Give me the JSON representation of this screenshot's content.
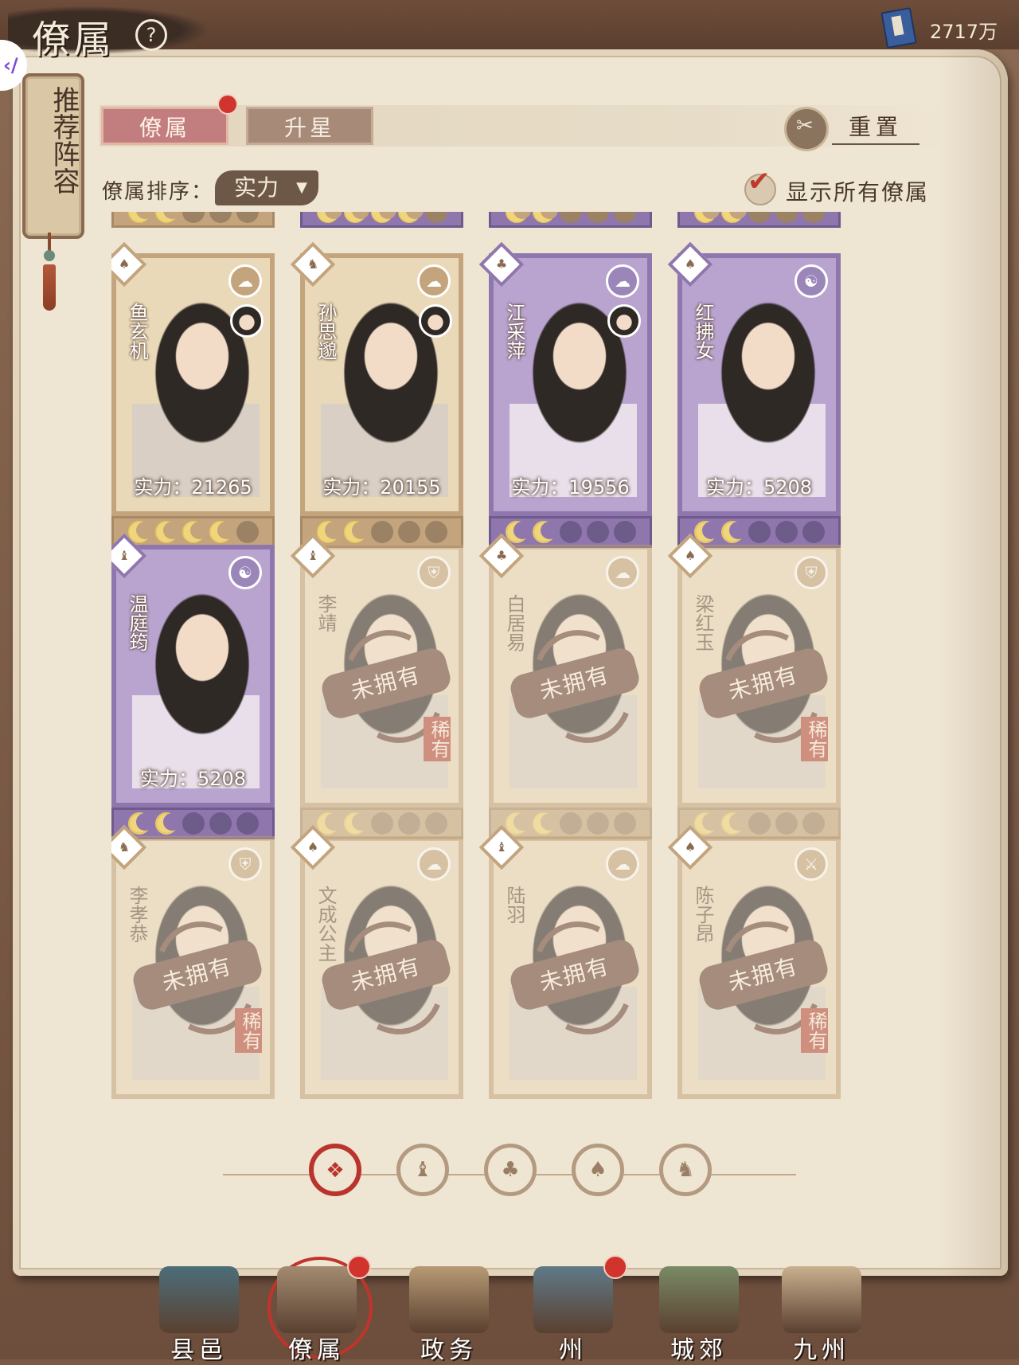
{
  "header": {
    "title": "僚属",
    "help_glyph": "?",
    "currency_value": "2717万",
    "side_button_glyph": "‹/"
  },
  "recommend_banner": "推荐阵容",
  "tabs": [
    {
      "label": "僚属",
      "active": true,
      "notify": true
    },
    {
      "label": "升星",
      "active": false,
      "notify": false
    }
  ],
  "reset_label": "重置",
  "sort": {
    "label": "僚属排序：",
    "value": "实力"
  },
  "show_all": {
    "label": "显示所有僚属",
    "checked": true
  },
  "partial_row_moons": [
    2,
    4,
    2,
    2
  ],
  "cards": [
    {
      "name": "鱼玄机",
      "power": "实力：21265",
      "moons": 4,
      "purple": false,
      "owned": true,
      "type_icon": "fan-icon",
      "emblem_icon": "cloud-emblem"
    },
    {
      "name": "孙思邈",
      "power": "实力：20155",
      "moons": 2,
      "purple": false,
      "owned": true,
      "type_icon": "lion-icon",
      "emblem_icon": "cloud-emblem"
    },
    {
      "name": "江采萍",
      "power": "实力：19556",
      "moons": 2,
      "purple": true,
      "owned": true,
      "type_icon": "gourd-icon",
      "emblem_icon": "cloud-emblem"
    },
    {
      "name": "红拂女",
      "power": "实力：5208",
      "moons": 2,
      "purple": true,
      "owned": true,
      "type_icon": "fan-icon",
      "emblem_icon": "yinyang-emblem"
    },
    {
      "name": "温庭筠",
      "power": "实力：5208",
      "moons": 2,
      "purple": true,
      "owned": true,
      "type_icon": "hat-icon",
      "emblem_icon": "yinyang-emblem"
    },
    {
      "name": "李靖",
      "unowned_label": "未拥有",
      "rare_label": "稀有",
      "moons": 2,
      "purple": false,
      "owned": false,
      "type_icon": "hat-icon",
      "emblem_icon": "shield-emblem"
    },
    {
      "name": "白居易",
      "unowned_label": "未拥有",
      "moons": 2,
      "purple": false,
      "owned": false,
      "type_icon": "gourd-icon",
      "emblem_icon": "cloud-emblem"
    },
    {
      "name": "梁红玉",
      "unowned_label": "未拥有",
      "rare_label": "稀有",
      "moons": 2,
      "purple": false,
      "owned": false,
      "type_icon": "fan-icon",
      "emblem_icon": "shield-emblem"
    },
    {
      "name": "李孝恭",
      "unowned_label": "未拥有",
      "rare_label": "稀有",
      "purple": false,
      "owned": false,
      "type_icon": "lion-icon",
      "emblem_icon": "shield-emblem"
    },
    {
      "name": "文成公主",
      "unowned_label": "未拥有",
      "purple": false,
      "owned": false,
      "type_icon": "fan-icon",
      "emblem_icon": "cloud-emblem"
    },
    {
      "name": "陆羽",
      "unowned_label": "未拥有",
      "purple": false,
      "owned": false,
      "type_icon": "hat-icon",
      "emblem_icon": "cloud-emblem"
    },
    {
      "name": "陈子昂",
      "unowned_label": "未拥有",
      "rare_label": "稀有",
      "purple": false,
      "owned": false,
      "type_icon": "fan-icon",
      "emblem_icon": "sword-emblem"
    }
  ],
  "faction_filters": [
    {
      "icon": "all-icon",
      "glyph": "❖",
      "active": true
    },
    {
      "icon": "hat-icon",
      "glyph": "♝",
      "active": false
    },
    {
      "icon": "gourd-icon",
      "glyph": "♣",
      "active": false
    },
    {
      "icon": "fan-icon",
      "glyph": "♠",
      "active": false
    },
    {
      "icon": "lion-icon",
      "glyph": "♞",
      "active": false
    }
  ],
  "bottom_nav": [
    {
      "label": "县邑",
      "notify": false,
      "active": false,
      "color": "#4c6e7a"
    },
    {
      "label": "僚属",
      "notify": true,
      "active": true,
      "color": "#a38b70"
    },
    {
      "label": "政务",
      "notify": false,
      "active": false,
      "color": "#b79a74"
    },
    {
      "label": "州",
      "notify": true,
      "active": false,
      "color": "#5f7a88"
    },
    {
      "label": "城郊",
      "notify": false,
      "active": false,
      "color": "#7a8a66"
    },
    {
      "label": "九州",
      "notify": false,
      "active": false,
      "color": "#c9b08e"
    }
  ],
  "colors": {
    "accent_red": "#b9342c",
    "card_gold": "#c3a47c",
    "card_purple": "#8f77ad",
    "paper": "#efe5d3"
  }
}
